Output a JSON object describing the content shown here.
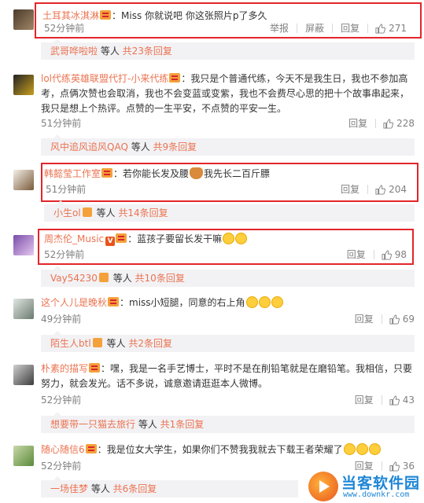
{
  "comments": [
    {
      "user": "土耳其冰淇淋",
      "text": "Miss 你就说吧 你这张照片p了多久",
      "time": "52分钟前",
      "actions": [
        "举报",
        "屏蔽",
        "回复"
      ],
      "likes": "271",
      "reply_user": "武哥哗啦啦",
      "reply_mid": " 等人 ",
      "reply_count": "共23条回复",
      "highlighted": true
    },
    {
      "user": "lol代练英雄联盟代打-小来代练",
      "text": "我只是个普通代练，今天不是我生日，我也不参加高考，点俩次赞也会取消，我也不会变蓝或变紫，我也不会费尽心思的把十个故事串起来，我只是想上个热评。点赞的一生平安，不点赞的平安一生。",
      "time": "51分钟前",
      "actions": [
        "回复"
      ],
      "likes": "228",
      "reply_user": "风中追风追风QAQ",
      "reply_mid": " 等人 ",
      "reply_count": "共9条回复",
      "highlighted": false
    },
    {
      "user": "韩懿莹工作室",
      "text": "若你能长发及腰",
      "text_after": "我先长二百斤膘",
      "time": "51分钟前",
      "actions": [
        "回复"
      ],
      "likes": "204",
      "reply_user": "小生ol",
      "reply_mid": " 等人 ",
      "reply_count": "共14条回复",
      "highlighted": true
    },
    {
      "user": "周杰伦_Music",
      "text": "蓝孩子要留长发干嘛",
      "time": "52分钟前",
      "actions": [
        "回复"
      ],
      "likes": "98",
      "reply_user": "Vay54230",
      "reply_mid": " 等人 ",
      "reply_count": "共10条回复",
      "highlighted": true
    },
    {
      "user": "这个人儿是晚秋",
      "text": "miss小短腿，同意的右上角",
      "time": "49分钟前",
      "actions": [
        "回复"
      ],
      "likes": "69",
      "reply_user": "陌生人btl",
      "reply_mid": " 等人 ",
      "reply_count": "共2条回复",
      "highlighted": false
    },
    {
      "user": "朴素的描写",
      "text": "嘿，我是一名手艺博士，平时不是在削铅笔就是在磨铅笔。我相信，只要努力，就会发光。话不多说，诚意邀请逛逛本人微博。",
      "time": "52分钟前",
      "actions": [
        "回复"
      ],
      "likes": "43",
      "reply_user": "想要带一只猫去旅行",
      "reply_mid": " 等人 ",
      "reply_count": "共1条回复",
      "highlighted": false
    },
    {
      "user": "随心随信6",
      "text": "我是位女大学生，如果你们不赞我我就去下载王者荣耀了",
      "time": "52分钟前",
      "actions": [
        "回复"
      ],
      "likes": "36",
      "reply_user": "一场佳梦",
      "reply_mid": " 等人 ",
      "reply_count": "共6条回复",
      "highlighted": false
    }
  ],
  "colors": {
    "username": "#eb7350",
    "highlight": "#e3252a",
    "reply_bg": "#f2f2f5",
    "muted": "#808080"
  },
  "watermark": {
    "title": "当客软件园",
    "url": "www.downkr.com"
  }
}
